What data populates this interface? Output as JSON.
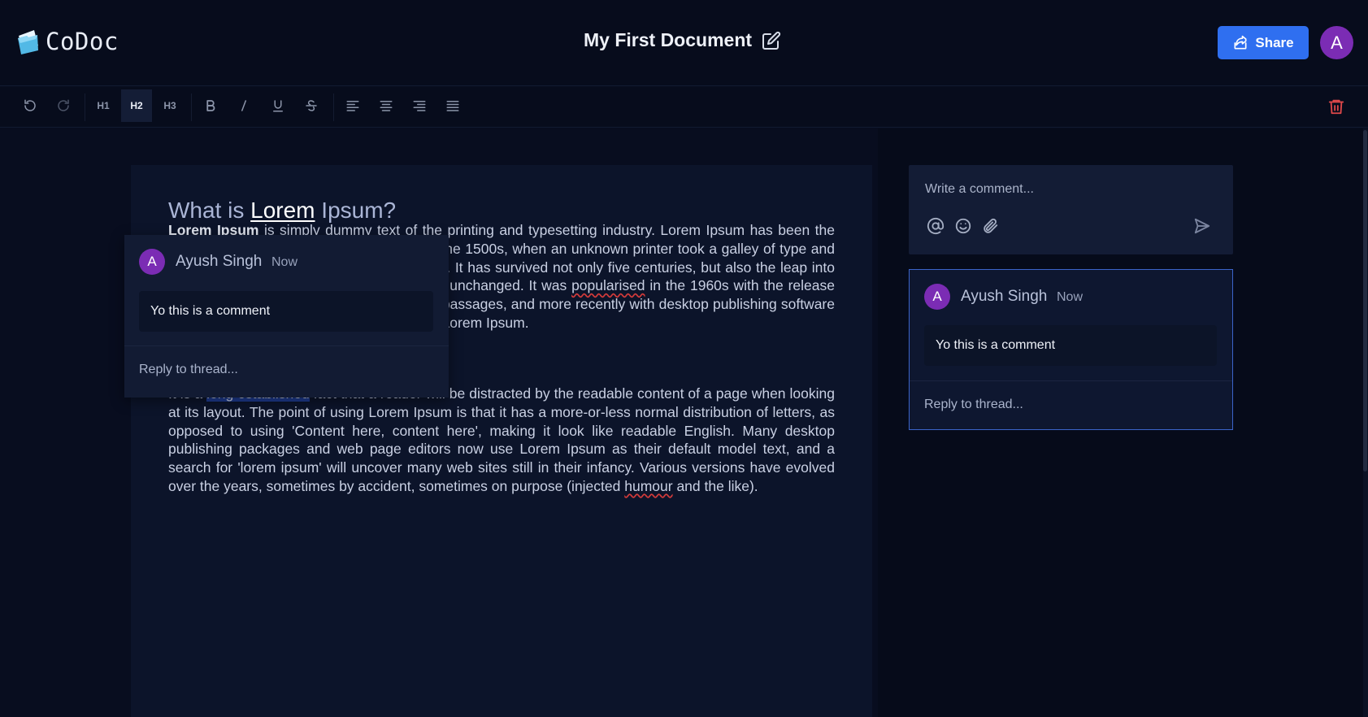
{
  "app": {
    "name": "CoDoc",
    "logo_icon": "folder-paper-icon"
  },
  "header": {
    "doc_title": "My First Document",
    "edit_icon": "edit-icon",
    "share_label": "Share",
    "share_icon": "share-icon",
    "user_initial": "A",
    "accent": "#2f6ff0",
    "avatar_color": "#7b2cb4"
  },
  "toolbar": {
    "undo_icon": "undo-icon",
    "redo_icon": "redo-icon",
    "h1": "H1",
    "h2": "H2",
    "h3": "H3",
    "active_heading": "H2",
    "bold_icon": "bold-icon",
    "italic_icon": "italic-icon",
    "underline_icon": "underline-icon",
    "strike_icon": "strikethrough-icon",
    "align_left_icon": "align-left-icon",
    "align_center_icon": "align-center-icon",
    "align_right_icon": "align-right-icon",
    "align_justify_icon": "align-justify-icon",
    "delete_icon": "trash-icon",
    "delete_color": "#e0484a"
  },
  "document": {
    "heading_before": "What is ",
    "heading_bold": "Lorem",
    "heading_after": " Ipsum?",
    "para1_bold": "Lorem Ipsum",
    "para1_a": " is simply dummy text of the printing and typesetting industry. Lorem Ipsum has been the industry's standard dummy text ever since the 1500s, when an unknown printer took a galley of type and scrambled it to make a type specimen book. It has survived not only five centuries, but also the leap into electronic typesetting, remaining essentially unchanged. It was ",
    "para1_misspelled": "popularised",
    "para1_b": " in the 1960s with the release of Letraset sheets containing Lorem Ipsum passages, and more recently with desktop publishing software like Aldus PageMaker including versions of Lorem Ipsum.",
    "para2_a": "It is a ",
    "para2_highlight": "long established",
    "para2_b": " fact that a reader will be distracted by the readable content of a page when looking at its layout. The point of using Lorem Ipsum is that it has a more-or-less normal distribution of letters, as opposed to using 'Content here, content here', making it look like readable English. Many desktop publishing packages and web page editors now use Lorem Ipsum as their default model text, and a search for 'lorem ipsum' will uncover many web sites still in their infancy. Various versions have evolved over the years, sometimes by accident, sometimes on purpose (injected ",
    "para2_misspelled": "humour",
    "para2_c": " and the like)."
  },
  "comments": {
    "input_placeholder": "Write a comment...",
    "mention_icon": "at-sign-icon",
    "emoji_icon": "smile-icon",
    "attach_icon": "paperclip-icon",
    "send_icon": "send-icon",
    "thread": {
      "initial": "A",
      "author": "Ayush Singh",
      "time": "Now",
      "body": "Yo this is a comment",
      "reply_placeholder": "Reply to thread..."
    }
  }
}
